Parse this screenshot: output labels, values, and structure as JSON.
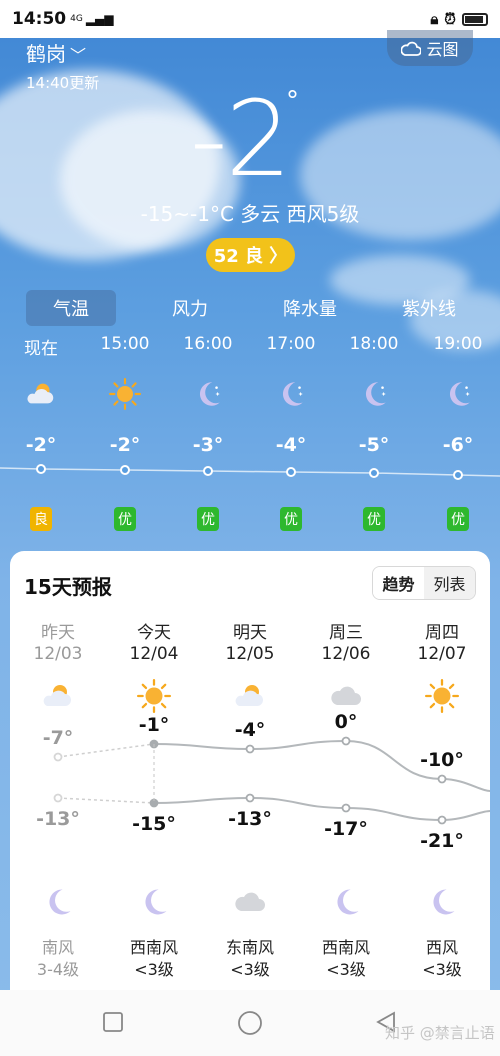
{
  "status_bar": {
    "time": "14:50",
    "network": "4G"
  },
  "location": {
    "city": "鹤岗",
    "updated": "14:40更新"
  },
  "cloud_map_button": "云图",
  "current": {
    "temperature": "-2",
    "degree_symbol": "°",
    "summary": "-15~-1°C 多云 西风5级",
    "aqi_label": "52 良 〉"
  },
  "tabs": [
    "气温",
    "风力",
    "降水量",
    "紫外线"
  ],
  "hourly": [
    {
      "time": "现在",
      "temp": "-2°",
      "icon": "partly-cloudy-icon",
      "aqi": "良",
      "aqi_color": "#f0b400"
    },
    {
      "time": "15:00",
      "temp": "-2°",
      "icon": "sun-icon",
      "aqi": "优",
      "aqi_color": "#2eb82e"
    },
    {
      "time": "16:00",
      "temp": "-3°",
      "icon": "moon-icon",
      "aqi": "优",
      "aqi_color": "#2eb82e"
    },
    {
      "time": "17:00",
      "temp": "-4°",
      "icon": "moon-icon",
      "aqi": "优",
      "aqi_color": "#2eb82e"
    },
    {
      "time": "18:00",
      "temp": "-5°",
      "icon": "moon-icon",
      "aqi": "优",
      "aqi_color": "#2eb82e"
    },
    {
      "time": "19:00",
      "temp": "-6°",
      "icon": "moon-icon",
      "aqi": "优",
      "aqi_color": "#2eb82e"
    }
  ],
  "forecast": {
    "title": "15天预报",
    "toggle": {
      "trend": "趋势",
      "list": "列表"
    },
    "days": [
      {
        "day": "昨天",
        "date": "12/03",
        "high": "-7°",
        "low": "-13°",
        "day_icon": "partly-cloudy-icon",
        "night_icon": "moon-icon",
        "wind": "南风",
        "level": "3-4级"
      },
      {
        "day": "今天",
        "date": "12/04",
        "high": "-1°",
        "low": "-15°",
        "day_icon": "sun-icon",
        "night_icon": "moon-icon",
        "wind": "西南风",
        "level": "<3级"
      },
      {
        "day": "明天",
        "date": "12/05",
        "high": "-4°",
        "low": "-13°",
        "day_icon": "partly-cloudy-icon",
        "night_icon": "cloud-icon",
        "wind": "东南风",
        "level": "<3级"
      },
      {
        "day": "周三",
        "date": "12/06",
        "high": "0°",
        "low": "-17°",
        "day_icon": "cloud-icon",
        "night_icon": "moon-icon",
        "wind": "西南风",
        "level": "<3级"
      },
      {
        "day": "周四",
        "date": "12/07",
        "high": "-10°",
        "low": "-21°",
        "day_icon": "sun-icon",
        "night_icon": "moon-icon",
        "wind": "西风",
        "level": "<3级"
      }
    ]
  },
  "watermark": "知乎 @禁言止语",
  "colors": {
    "sky": "#4f93d8",
    "aqi_yellow": "#f2c21a",
    "aqi_green": "#2eb82e",
    "sun": "#f6a81c"
  }
}
